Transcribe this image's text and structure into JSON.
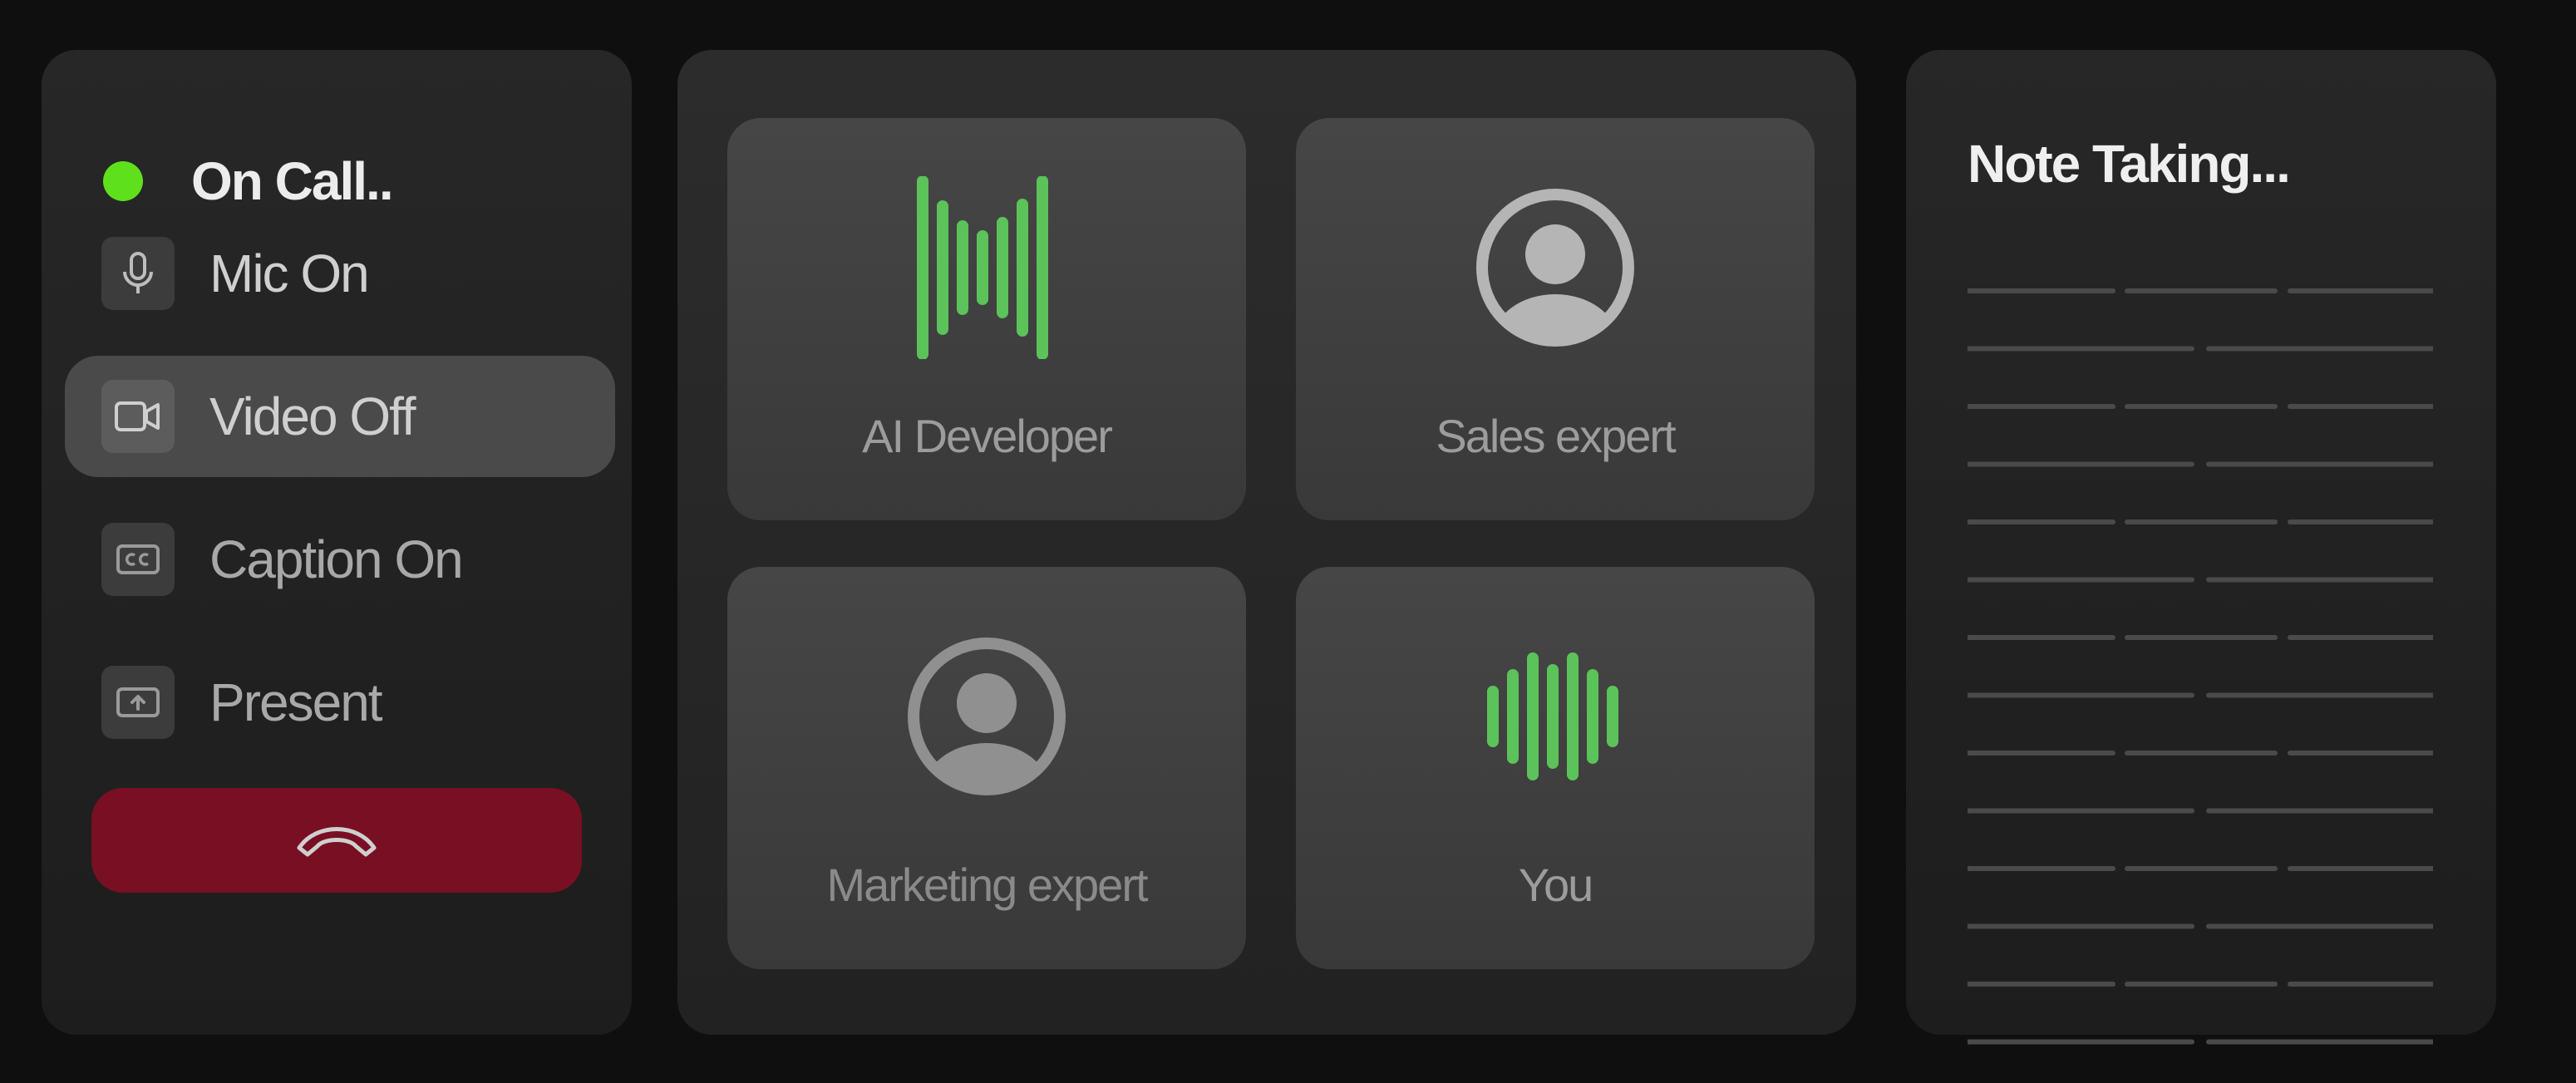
{
  "call_status": {
    "label": "On Call..",
    "indicator_color": "#5fe01c"
  },
  "controls": {
    "mic": {
      "label": "Mic On",
      "icon": "mic-icon"
    },
    "video": {
      "label": "Video Off",
      "icon": "video-camera-icon",
      "active": true
    },
    "caption": {
      "label": "Caption On",
      "icon": "closed-caption-icon"
    },
    "present": {
      "label": "Present",
      "icon": "present-screen-icon"
    },
    "hangup": {
      "icon": "phone-hangup-icon",
      "color": "#780f22"
    }
  },
  "participants": [
    {
      "name": "AI Developer",
      "avatar": "speaking-waveform-icon",
      "speaking": true
    },
    {
      "name": "Sales expert",
      "avatar": "user-avatar-icon",
      "speaking": false
    },
    {
      "name": "Marketing expert",
      "avatar": "user-avatar-icon",
      "speaking": false
    },
    {
      "name": "You",
      "avatar": "speaking-waveform-icon",
      "speaking": true
    }
  ],
  "notes": {
    "title": "Note Taking..."
  },
  "colors": {
    "accent_green": "#5cc25a",
    "background": "#0f0f0f",
    "panel": "#252525"
  }
}
